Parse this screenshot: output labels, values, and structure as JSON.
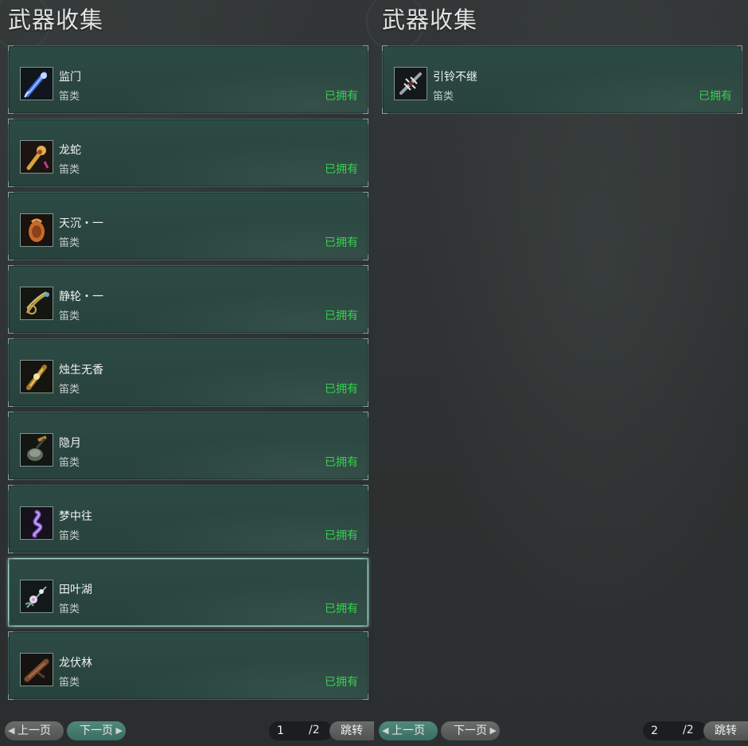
{
  "panels": [
    {
      "title": "武器收集",
      "items": [
        {
          "name": "监门",
          "type": "笛类",
          "status": "已拥有",
          "icon": "blue-flute-weapon-icon"
        },
        {
          "name": "龙蛇",
          "type": "笛类",
          "status": "已拥有",
          "icon": "golden-dragon-flute-icon"
        },
        {
          "name": "天沉・一",
          "type": "笛类",
          "status": "已拥有",
          "icon": "orange-gourd-flute-icon"
        },
        {
          "name": "静轮・一",
          "type": "笛类",
          "status": "已拥有",
          "icon": "brass-wheel-flute-icon"
        },
        {
          "name": "烛生无香",
          "type": "笛类",
          "status": "已拥有",
          "icon": "gold-candle-flute-icon"
        },
        {
          "name": "隐月",
          "type": "笛类",
          "status": "已拥有",
          "icon": "bell-moon-flute-icon"
        },
        {
          "name": "梦中往",
          "type": "笛类",
          "status": "已拥有",
          "icon": "purple-spiral-flute-icon"
        },
        {
          "name": "田叶湖",
          "type": "笛类",
          "status": "已拥有",
          "icon": "lotus-flower-flute-icon",
          "selected": true
        },
        {
          "name": "龙伏林",
          "type": "笛类",
          "status": "已拥有",
          "icon": "brown-wooden-flute-icon"
        }
      ],
      "footer": {
        "prev_label": "上一页",
        "next_label": "下一页",
        "page_value": "1",
        "page_total": "/2",
        "jump_label": "跳转",
        "active": "next"
      }
    },
    {
      "title": "武器收集",
      "items": [
        {
          "name": "引铃不继",
          "type": "笛类",
          "status": "已拥有",
          "icon": "silver-winged-flute-icon"
        }
      ],
      "footer": {
        "prev_label": "上一页",
        "next_label": "下一页",
        "page_value": "2",
        "page_total": "/2",
        "jump_label": "跳转",
        "active": "prev"
      }
    }
  ],
  "colors": {
    "owned_status": "#35d24f",
    "card_bg": "#2c4a44",
    "selected_border": "#9fd8cc"
  }
}
